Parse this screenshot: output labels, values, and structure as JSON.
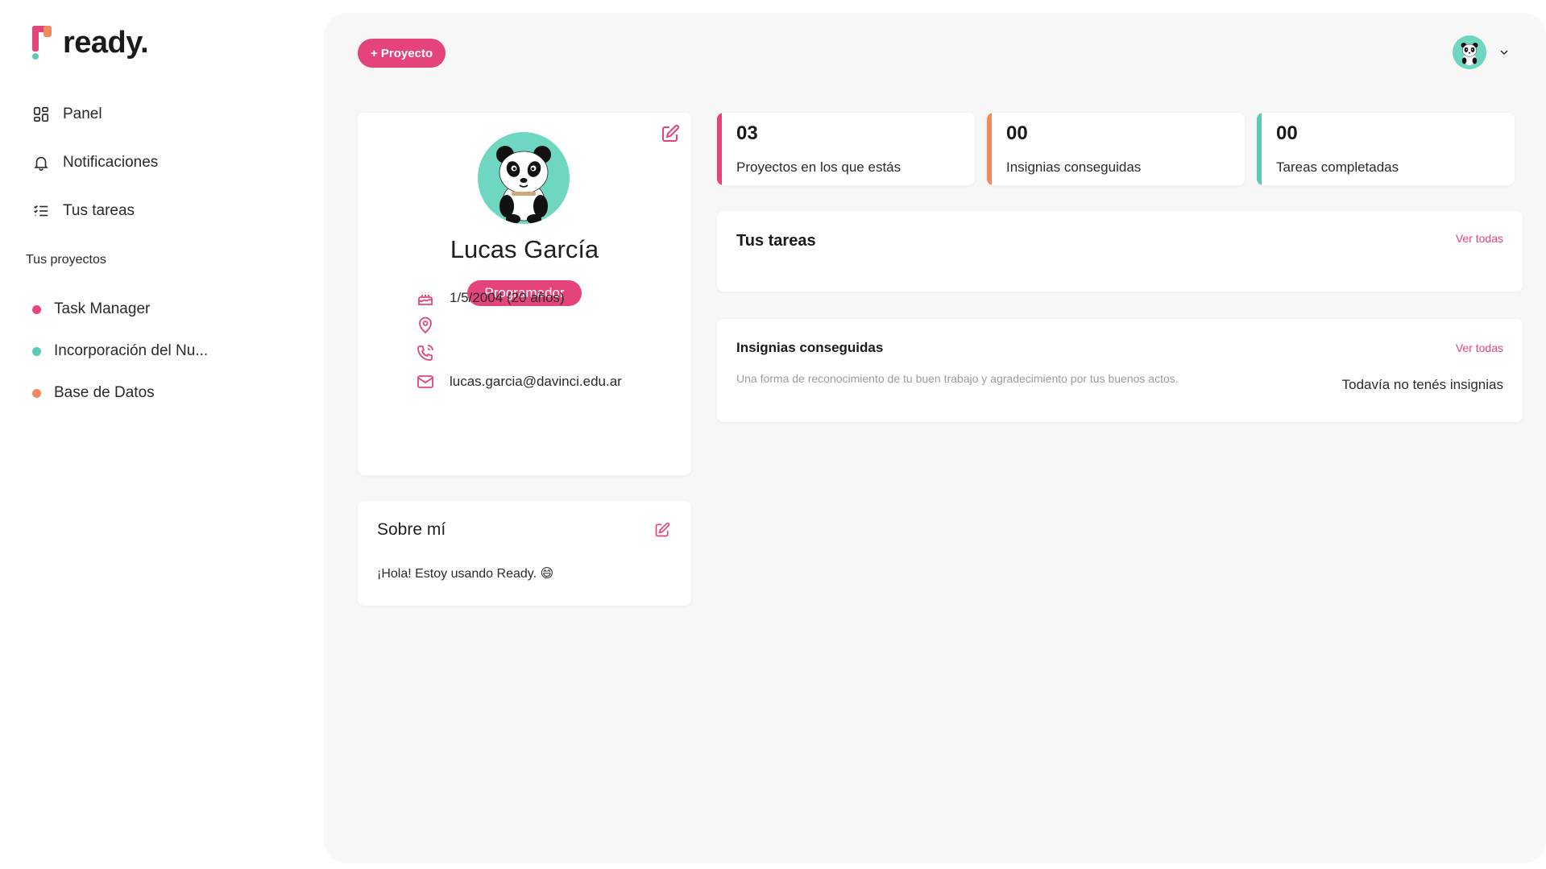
{
  "app": {
    "logo_text": "ready."
  },
  "sidebar": {
    "nav": [
      {
        "label": "Panel",
        "icon": "dashboard-icon"
      },
      {
        "label": "Notificaciones",
        "icon": "bell-icon"
      },
      {
        "label": "Tus tareas",
        "icon": "task-list-icon"
      }
    ],
    "projects_title": "Tus proyectos",
    "projects": [
      {
        "label": "Task Manager",
        "color": "#e4447b"
      },
      {
        "label": "Incorporación del Nu...",
        "color": "#5bcbb7"
      },
      {
        "label": "Base de Datos",
        "color": "#f08a5d"
      }
    ]
  },
  "header": {
    "new_project_label": "+ Proyecto",
    "avatar": "panda-avatar"
  },
  "profile": {
    "name": "Lucas García",
    "role": "Programador",
    "birthday": "1/5/2004 (20 años)",
    "location": "",
    "phone": "",
    "email": "lucas.garcia@davinci.edu.ar"
  },
  "about": {
    "title": "Sobre mí",
    "text": "¡Hola! Estoy usando Ready. 😄"
  },
  "stats": [
    {
      "value": "03",
      "label": "Proyectos en los que estás",
      "color": "#e4447b"
    },
    {
      "value": "00",
      "label": "Insignias conseguidas",
      "color": "#f08a5d"
    },
    {
      "value": "00",
      "label": "Tareas completadas",
      "color": "#5bcbb7"
    }
  ],
  "tasks": {
    "title": "Tus tareas",
    "see_all": "Ver todas"
  },
  "badges": {
    "title": "Insignias conseguidas",
    "see_all": "Ver todas",
    "description": "Una forma de reconocimiento de tu buen trabajo y agradecimiento por tus buenos actos.",
    "empty": "Todavía no tenés insignias"
  },
  "colors": {
    "accent": "#e4447b",
    "orange": "#f08a5d",
    "teal": "#5bcbb7",
    "background": "#f7f7f7"
  }
}
